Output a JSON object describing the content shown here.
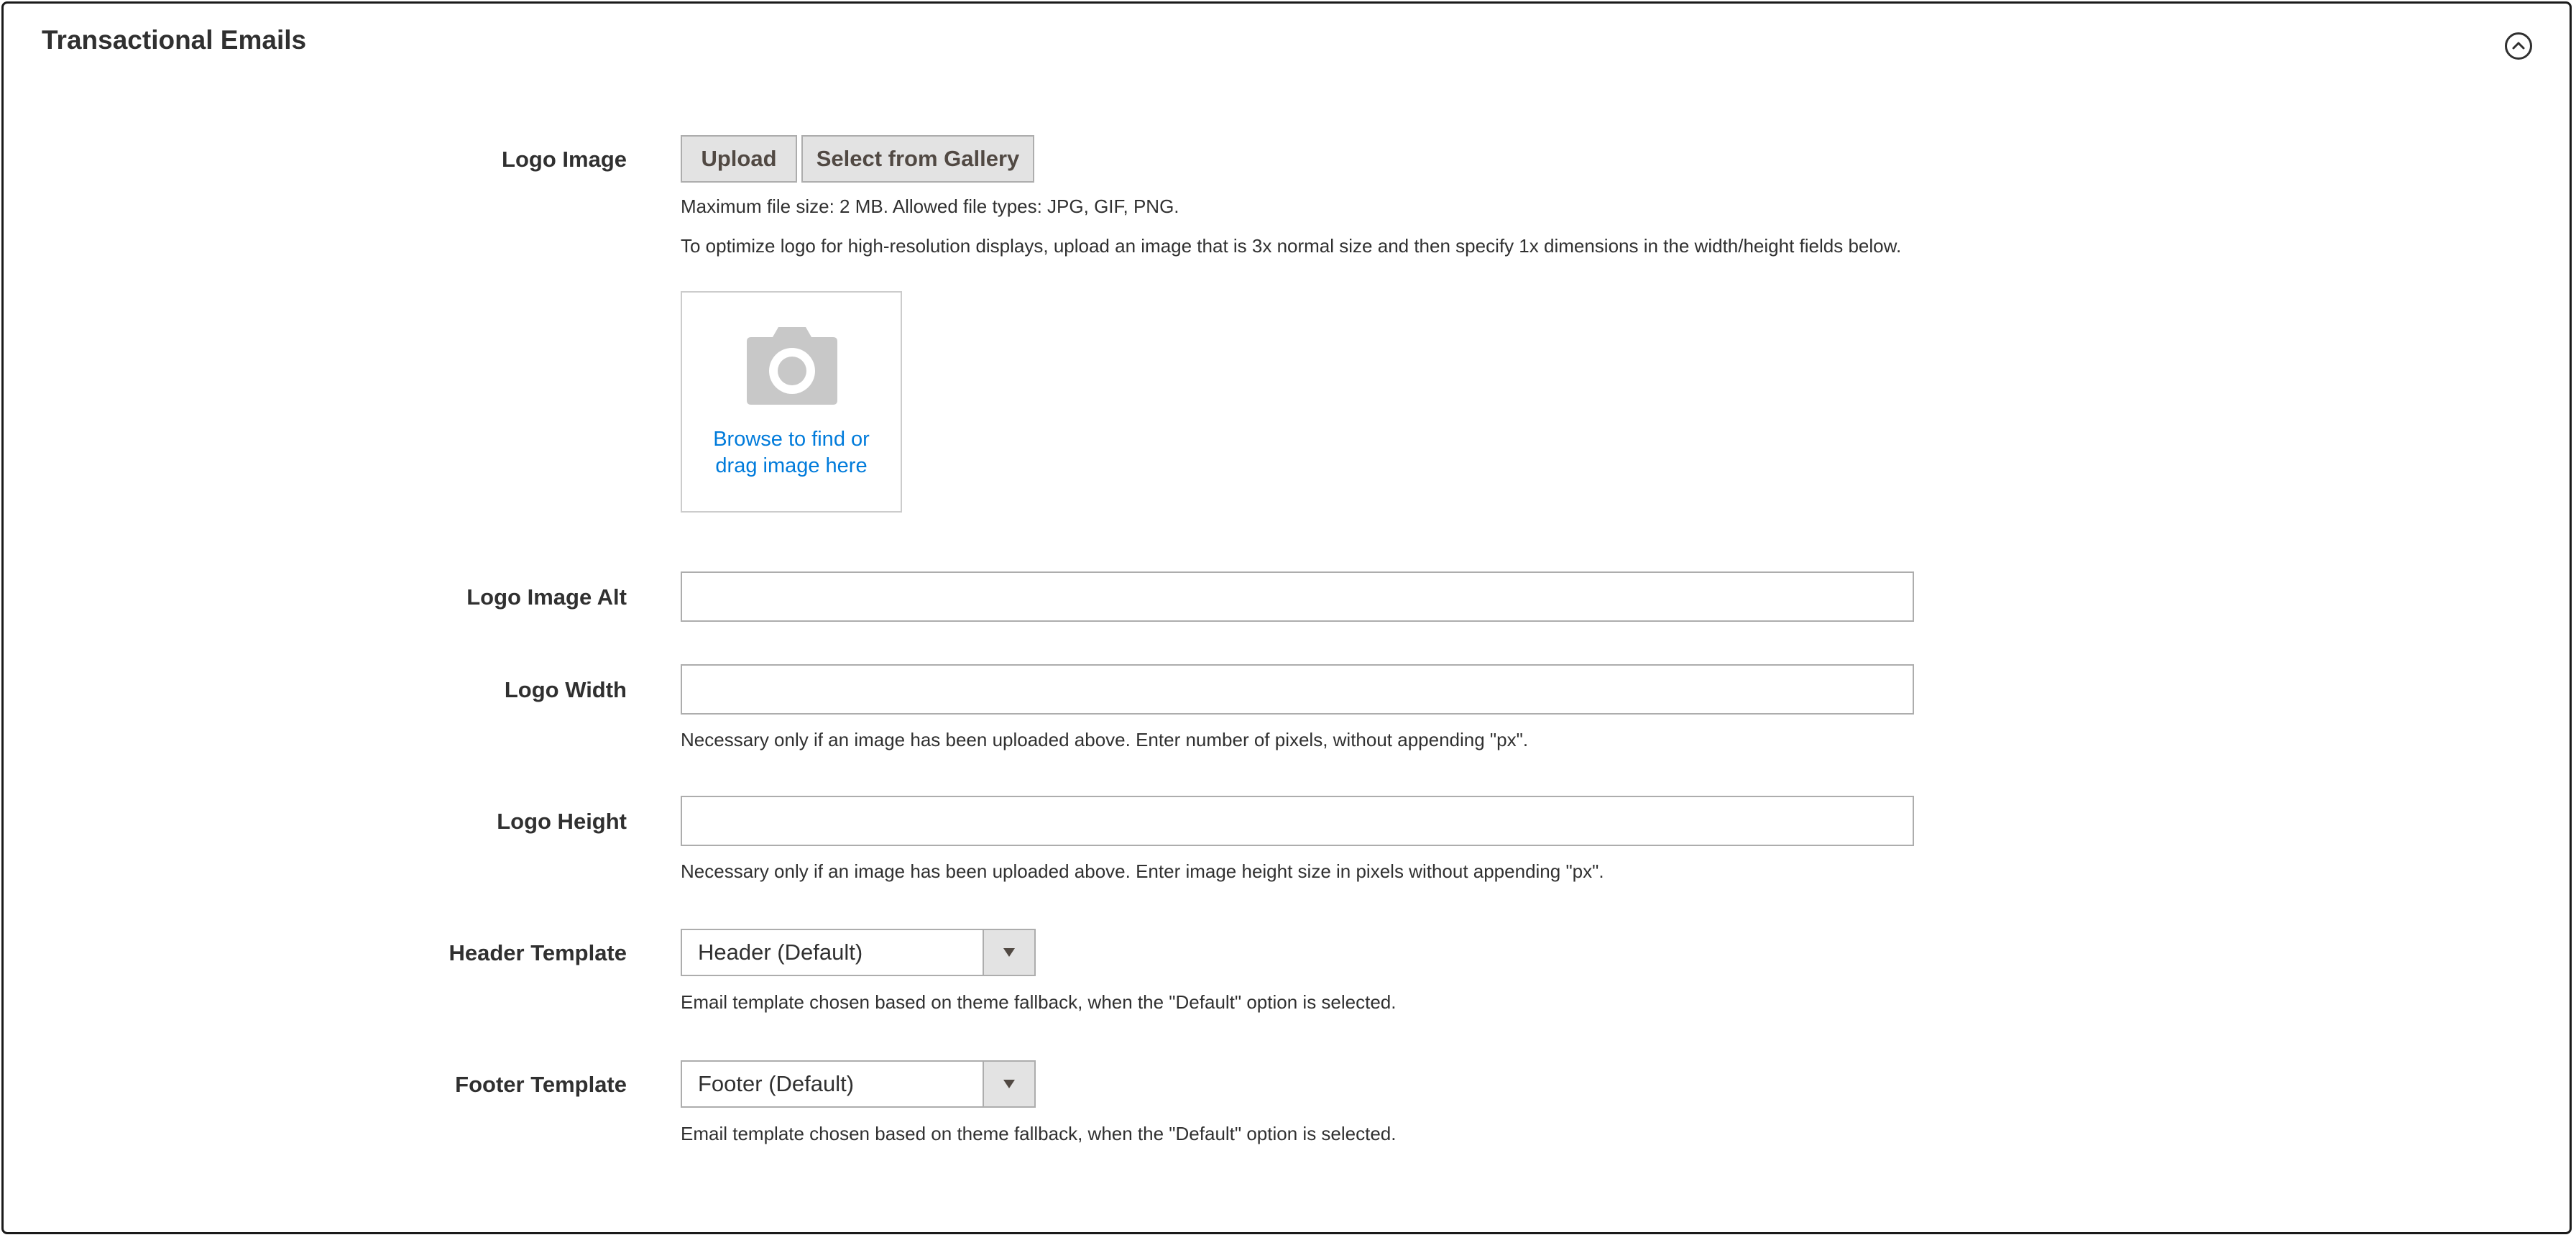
{
  "section": {
    "title": "Transactional Emails",
    "collapse_icon": "chevron-up-circle-icon"
  },
  "logo_image": {
    "label": "Logo Image",
    "upload_label": "Upload",
    "gallery_label": "Select from Gallery",
    "note_size": "Maximum file size: 2 MB. Allowed file types: JPG, GIF, PNG.",
    "note_resolution": "To optimize logo for high-resolution displays, upload an image that is 3x normal size and then specify 1x dimensions in the width/height fields below.",
    "dropzone_icon": "camera-icon",
    "dropzone_line1": "Browse to find or",
    "dropzone_line2": "drag image here"
  },
  "logo_image_alt": {
    "label": "Logo Image Alt",
    "value": ""
  },
  "logo_width": {
    "label": "Logo Width",
    "value": "",
    "note": "Necessary only if an image has been uploaded above. Enter number of pixels, without appending \"px\"."
  },
  "logo_height": {
    "label": "Logo Height",
    "value": "",
    "note": "Necessary only if an image has been uploaded above. Enter image height size in pixels without appending \"px\"."
  },
  "header_template": {
    "label": "Header Template",
    "selected": "Header (Default)",
    "note": "Email template chosen based on theme fallback, when the \"Default\" option is selected."
  },
  "footer_template": {
    "label": "Footer Template",
    "selected": "Footer (Default)",
    "note": "Email template chosen based on theme fallback, when the \"Default\" option is selected."
  },
  "colors": {
    "link": "#007bdb",
    "button_bg": "#e3e3e3",
    "border": "#adadad",
    "text": "#303030",
    "icon": "#c8c8c8"
  }
}
